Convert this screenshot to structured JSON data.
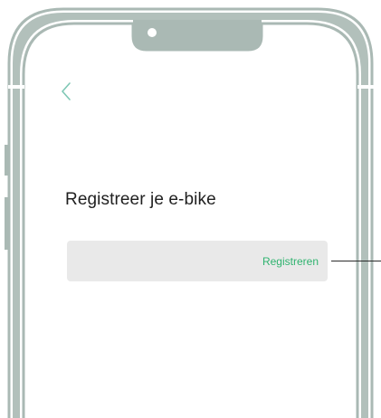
{
  "colors": {
    "frame": "#aab9b4",
    "accent": "#2fb36f",
    "back_chevron": "#7fc7b5",
    "bar_background": "#e9e9e9",
    "text": "#1f1f1f",
    "callout": "#2b2b2b"
  },
  "header": {
    "back_icon": "chevron-left-icon"
  },
  "main": {
    "title": "Registreer je e-bike",
    "register_label": "Registreren"
  }
}
